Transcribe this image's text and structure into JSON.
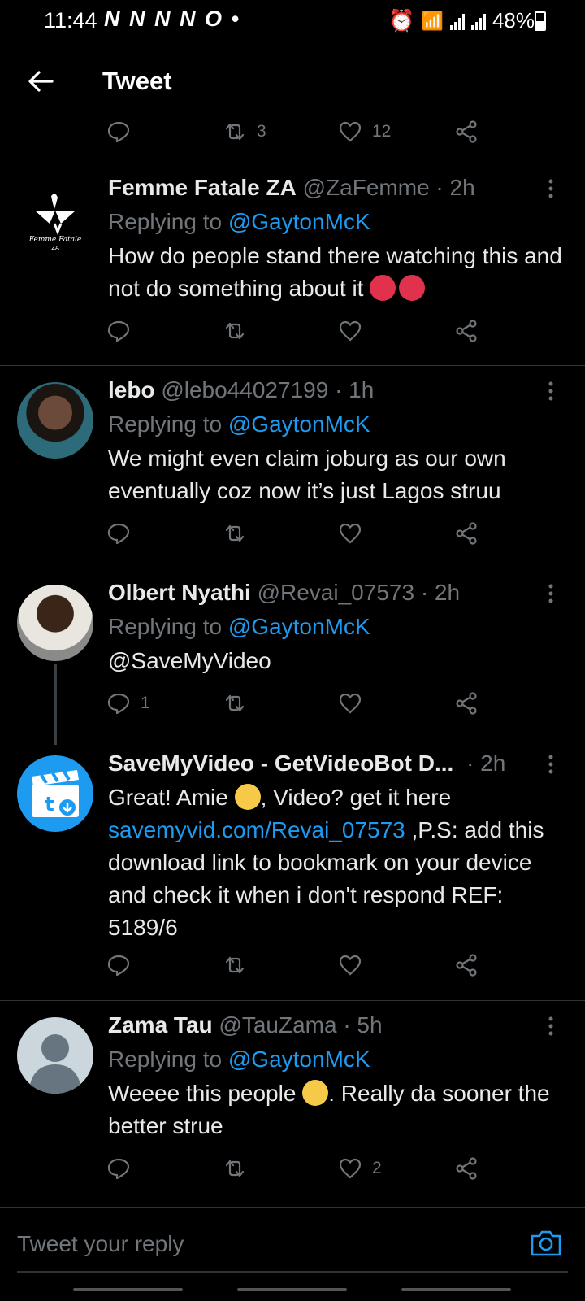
{
  "status_bar": {
    "time": "11:44",
    "notification_icons": "N N N N O •",
    "battery": "48%"
  },
  "header": {
    "title": "Tweet"
  },
  "top_actions": {
    "retweets": "3",
    "likes": "12"
  },
  "tweets": [
    {
      "name": "Femme Fatale ZA",
      "handle": "@ZaFemme",
      "time": "· 2h",
      "replying_prefix": "Replying to",
      "replying_to": "@GaytonMcK",
      "text": "How do people stand there watching this and not do something about it",
      "logo_text": "Femme Fatale ZA",
      "emoji": [
        "angry-face",
        "angry-face"
      ]
    },
    {
      "name": "lebo",
      "handle": "@lebo44027199",
      "time": "· 1h",
      "replying_prefix": "Replying to",
      "replying_to": "@GaytonMcK",
      "text": "We might even claim joburg as our own eventually coz now it’s just Lagos struu"
    },
    {
      "name": "Olbert Nyathi",
      "handle": "@Revai_07573",
      "time": "· 2h",
      "replying_prefix": "Replying to",
      "replying_to": "@GaytonMcK",
      "mention": "@SaveMyVideo",
      "reply_count": "1"
    },
    {
      "name": "SaveMyVideo - GetVideoBot D...",
      "time": "· 2h",
      "text_a": "Great! Amie",
      "text_b": ", Video? get it here",
      "link": "savemyvid.com/Revai_07573",
      "text_c": " ,P.S: add this download link to bookmark on your device and check it when i don't respond REF: 5189/6"
    },
    {
      "name": "Zama Tau",
      "handle": "@TauZama",
      "time": "· 5h",
      "replying_prefix": "Replying to",
      "replying_to": "@GaytonMcK",
      "text_a": "Weeee this people",
      "text_b": ".  Really da sooner the better strue",
      "like_count": "2"
    }
  ],
  "composer": {
    "placeholder": "Tweet your reply"
  },
  "colors": {
    "background": "#000000",
    "link": "#1d9bf0",
    "muted": "#71767b",
    "divider": "#2f3336"
  }
}
